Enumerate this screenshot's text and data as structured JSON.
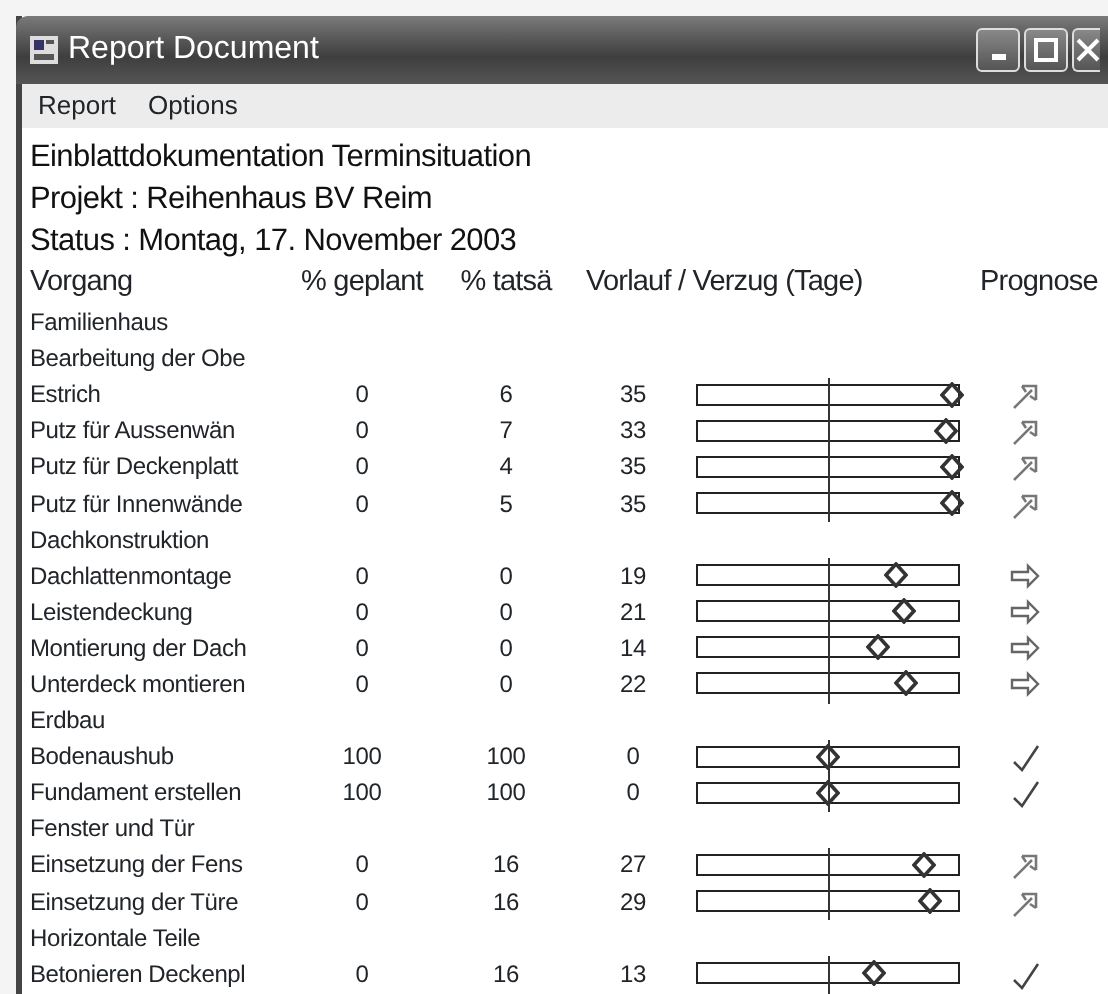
{
  "window": {
    "title": "Report Document"
  },
  "menu": [
    "Report",
    "Options"
  ],
  "header_lines": [
    "Einblattdokumentation Terminsituation",
    "Projekt : Reihenhaus BV Reim",
    "Status : Montag, 17. November 2003"
  ],
  "columns": [
    "Vorgang",
    "% geplant",
    "% tatsä",
    "Vorlauf / Verzug (Tage)",
    "Prognose"
  ],
  "rows": [
    {
      "name": "Familienhaus",
      "children": [
        {
          "name": "Bearbeitung der Obe",
          "children": [
            {
              "name": "Estrich",
              "planned": "0",
              "actual": "6",
              "days": "35",
              "level": 0.98,
              "forecast": {
                "kind": "up"
              }
            },
            {
              "name": "Putz für Aussenwän",
              "planned": "0",
              "actual": "7",
              "days": "33",
              "level": 0.95,
              "forecast": {
                "kind": "up"
              }
            },
            {
              "name": "Putz für Deckenplatt",
              "planned": "0",
              "actual": "4",
              "days": "35",
              "level": 0.98,
              "forecast": {
                "kind": "up"
              }
            },
            {
              "name": "Putz für Innenwände",
              "planned": "0",
              "actual": "5",
              "days": "35",
              "level": 0.98,
              "forecast": {
                "kind": "up"
              }
            }
          ]
        },
        {
          "name": "Dachkonstruktion",
          "children": [
            {
              "name": "Dachlattenmontage",
              "planned": "0",
              "actual": "0",
              "days": "19",
              "level": 0.76,
              "forecast": {
                "kind": "right"
              }
            },
            {
              "name": "Leistendeckung",
              "planned": "0",
              "actual": "0",
              "days": "21",
              "level": 0.79,
              "forecast": {
                "kind": "right"
              }
            },
            {
              "name": "Montierung der Dach",
              "planned": "0",
              "actual": "0",
              "days": "14",
              "level": 0.69,
              "forecast": {
                "kind": "right"
              }
            },
            {
              "name": "Unterdeck montieren",
              "planned": "0",
              "actual": "0",
              "days": "22",
              "level": 0.8,
              "forecast": {
                "kind": "right"
              }
            }
          ]
        },
        {
          "name": "Erdbau",
          "children": [
            {
              "name": "Bodenaushub",
              "planned": "100",
              "actual": "100",
              "days": "0",
              "level": 0.5,
              "forecast": {
                "kind": "check"
              }
            },
            {
              "name": "Fundament erstellen",
              "planned": "100",
              "actual": "100",
              "days": "0",
              "level": 0.5,
              "forecast": {
                "kind": "check"
              }
            }
          ]
        },
        {
          "name": "Fenster und Tür",
          "children": [
            {
              "name": "Einsetzung der Fens",
              "planned": "0",
              "actual": "16",
              "days": "27",
              "level": 0.87,
              "forecast": {
                "kind": "up"
              }
            },
            {
              "name": "Einsetzung der Türe",
              "planned": "0",
              "actual": "16",
              "days": "29",
              "level": 0.89,
              "forecast": {
                "kind": "up"
              }
            }
          ]
        },
        {
          "name": "Horizontale Teile",
          "children": [
            {
              "name": "Betonieren Deckenpl",
              "planned": "0",
              "actual": "16",
              "days": "13",
              "level": 0.68,
              "forecast": {
                "kind": "check"
              }
            }
          ]
        }
      ]
    }
  ]
}
